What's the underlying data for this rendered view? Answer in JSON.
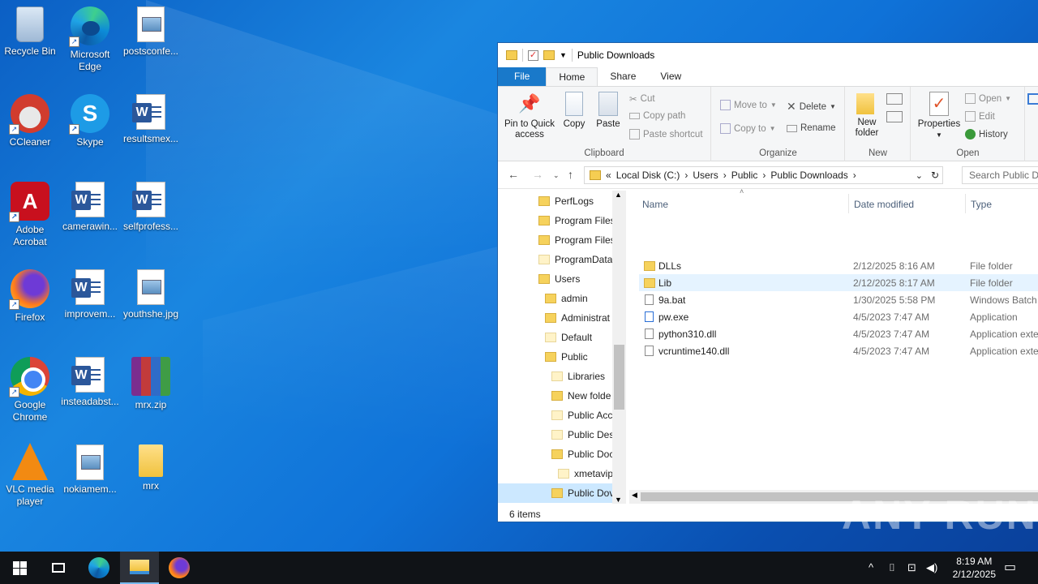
{
  "desktop": {
    "icons": [
      {
        "label": "Recycle Bin"
      },
      {
        "label": "Microsoft Edge"
      },
      {
        "label": "postsconfe..."
      },
      {
        "label": "CCleaner"
      },
      {
        "label": "Skype"
      },
      {
        "label": "resultsmex..."
      },
      {
        "label": "Adobe Acrobat"
      },
      {
        "label": "camerawin..."
      },
      {
        "label": "selfprofess..."
      },
      {
        "label": "Firefox"
      },
      {
        "label": "improvem..."
      },
      {
        "label": "youthshe.jpg"
      },
      {
        "label": "Google Chrome"
      },
      {
        "label": "insteadabst..."
      },
      {
        "label": "mrx.zip"
      },
      {
        "label": "VLC media player"
      },
      {
        "label": "nokiamem..."
      },
      {
        "label": "mrx"
      }
    ]
  },
  "explorer": {
    "title": "Public Downloads",
    "tabs": {
      "file": "File",
      "home": "Home",
      "share": "Share",
      "view": "View"
    },
    "ribbon": {
      "clipboard": {
        "pin": "Pin to Quick access",
        "copy": "Copy",
        "paste": "Paste",
        "cut": "Cut",
        "copy_path": "Copy path",
        "paste_shortcut": "Paste shortcut",
        "label": "Clipboard"
      },
      "organize": {
        "move_to": "Move to",
        "copy_to": "Copy to",
        "delete": "Delete",
        "rename": "Rename",
        "label": "Organize"
      },
      "new": {
        "new_folder": "New folder",
        "label": "New"
      },
      "open": {
        "properties": "Properties",
        "open": "Open",
        "edit": "Edit",
        "history": "History",
        "label": "Open"
      }
    },
    "address": {
      "prefix": "«",
      "crumbs": [
        "Local Disk (C:)",
        "Users",
        "Public",
        "Public Downloads"
      ],
      "search_placeholder": "Search Public Do"
    },
    "nav_tree": [
      {
        "label": "PerfLogs"
      },
      {
        "label": "Program Files"
      },
      {
        "label": "Program Files"
      },
      {
        "label": "ProgramData"
      },
      {
        "label": "Users"
      },
      {
        "label": "admin"
      },
      {
        "label": "Administrat"
      },
      {
        "label": "Default"
      },
      {
        "label": "Public"
      },
      {
        "label": "Libraries"
      },
      {
        "label": "New folde"
      },
      {
        "label": "Public Acc"
      },
      {
        "label": "Public Des"
      },
      {
        "label": "Public Doc"
      },
      {
        "label": "xmetavip"
      },
      {
        "label": "Public Dov"
      }
    ],
    "columns": {
      "name": "Name",
      "date": "Date modified",
      "type": "Type"
    },
    "files": [
      {
        "name": "DLLs",
        "date": "2/12/2025 8:16 AM",
        "type": "File folder",
        "kind": "folder"
      },
      {
        "name": "Lib",
        "date": "2/12/2025 8:17 AM",
        "type": "File folder",
        "kind": "folder"
      },
      {
        "name": "9a.bat",
        "date": "1/30/2025 5:58 PM",
        "type": "Windows Batch",
        "kind": "file"
      },
      {
        "name": "pw.exe",
        "date": "4/5/2023 7:47 AM",
        "type": "Application",
        "kind": "file"
      },
      {
        "name": "python310.dll",
        "date": "4/5/2023 7:47 AM",
        "type": "Application exte",
        "kind": "file"
      },
      {
        "name": "vcruntime140.dll",
        "date": "4/5/2023 7:47 AM",
        "type": "Application exte",
        "kind": "file"
      }
    ],
    "status": "6 items"
  },
  "taskbar": {
    "time": "8:19 AM",
    "date": "2/12/2025"
  },
  "watermark": "ANY RUN",
  "colors": {
    "accent": "#1979ca",
    "selection": "#cce8ff",
    "taskbar": "#101317"
  }
}
